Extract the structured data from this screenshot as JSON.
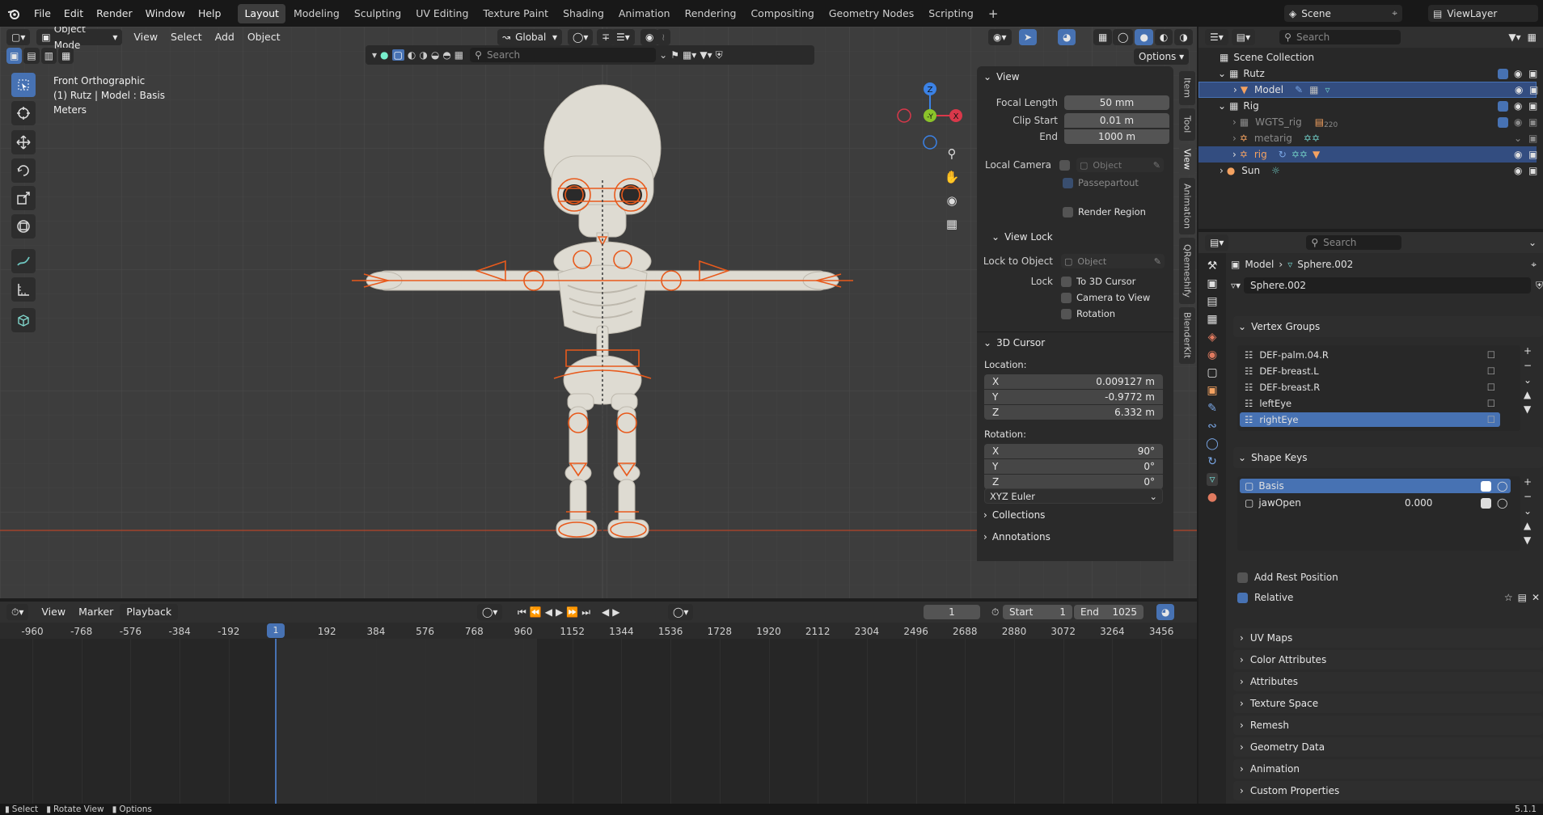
{
  "topbar": {
    "menus": [
      "File",
      "Edit",
      "Render",
      "Window",
      "Help"
    ],
    "workspaces": [
      "Layout",
      "Modeling",
      "Sculpting",
      "UV Editing",
      "Texture Paint",
      "Shading",
      "Animation",
      "Rendering",
      "Compositing",
      "Geometry Nodes",
      "Scripting"
    ],
    "active_workspace": "Layout",
    "scene": "Scene",
    "view_layer": "ViewLayer"
  },
  "viewport": {
    "mode": "Object Mode",
    "menus": [
      "View",
      "Select",
      "Add",
      "Object"
    ],
    "transform_orientation": "Global",
    "search_placeholder": "Search",
    "options_label": "Options",
    "overlay_info": [
      "Front Orthographic",
      "(1) Rutz | Model : Basis",
      "Meters"
    ],
    "gizmo_axes": {
      "z": "Z",
      "y": "-Y",
      "x": "X"
    }
  },
  "npanel": {
    "tabs": [
      "Item",
      "Tool",
      "View",
      "Animation",
      "QRemeshify",
      "BlenderKit"
    ],
    "active_tab": "View",
    "view": {
      "title": "View",
      "focal_length_label": "Focal Length",
      "focal_length": "50 mm",
      "clip_start_label": "Clip Start",
      "clip_start": "0.01 m",
      "end_label": "End",
      "end": "1000 m",
      "local_camera_label": "Local Camera",
      "object_placeholder": "Object",
      "passepartout_label": "Passepartout",
      "render_region_label": "Render Region"
    },
    "view_lock": {
      "title": "View Lock",
      "lock_to_object_label": "Lock to Object",
      "object_placeholder": "Object",
      "lock_label": "Lock",
      "to_3d_cursor": "To 3D Cursor",
      "camera_to_view": "Camera to View",
      "rotation": "Rotation"
    },
    "cursor": {
      "title": "3D Cursor",
      "location_label": "Location:",
      "loc_x": "0.009127 m",
      "loc_y": "-0.9772 m",
      "loc_z": "6.332 m",
      "rotation_label": "Rotation:",
      "rot_x": "90°",
      "rot_y": "0°",
      "rot_z": "0°",
      "axis_x": "X",
      "axis_y": "Y",
      "axis_z": "Z",
      "rotation_mode": "XYZ Euler"
    },
    "collections": "Collections",
    "annotations": "Annotations"
  },
  "outliner": {
    "search_placeholder": "Search",
    "items": [
      {
        "label": "Scene Collection"
      },
      {
        "label": "Rutz"
      },
      {
        "label": "Model"
      },
      {
        "label": "Rig"
      },
      {
        "label": "WGTS_rig",
        "extra": "220"
      },
      {
        "label": "metarig"
      },
      {
        "label": "rig"
      },
      {
        "label": "Sun"
      }
    ]
  },
  "properties": {
    "search_placeholder": "Search",
    "breadcrumb_object": "Model",
    "breadcrumb_data": "Sphere.002",
    "data_name": "Sphere.002",
    "vertex_groups_title": "Vertex Groups",
    "vertex_groups": [
      "DEF-palm.04.R",
      "DEF-breast.L",
      "DEF-breast.R",
      "leftEye",
      "rightEye"
    ],
    "shape_keys_title": "Shape Keys",
    "shape_keys": [
      {
        "name": "Basis",
        "value": ""
      },
      {
        "name": "jawOpen",
        "value": "0.000"
      }
    ],
    "add_rest_position": "Add Rest Position",
    "relative": "Relative",
    "sections": [
      "UV Maps",
      "Color Attributes",
      "Attributes",
      "Texture Space",
      "Remesh",
      "Geometry Data",
      "Animation",
      "Custom Properties"
    ]
  },
  "timeline": {
    "menus": [
      "View",
      "Marker",
      "Playback"
    ],
    "current_frame": "1",
    "start_label": "Start",
    "start": "1",
    "end_label": "End",
    "end": "1025",
    "ticks": [
      "-960",
      "-768",
      "-576",
      "-384",
      "-192",
      "1",
      "192",
      "384",
      "576",
      "768",
      "960",
      "1152",
      "1344",
      "1536",
      "1728",
      "1920",
      "2112",
      "2304",
      "2496",
      "2688",
      "2880",
      "3072",
      "3264",
      "3456"
    ]
  },
  "statusbar": {
    "items": [
      "Select",
      "Rotate View",
      "Options"
    ],
    "version": "5.1.1"
  },
  "colors": {
    "accent": "#4772b3",
    "selection": "#334d80",
    "armature": "#e85a1c",
    "x_axis": "#d9384a",
    "y_axis": "#8bc32a",
    "z_axis": "#3b82e6"
  }
}
